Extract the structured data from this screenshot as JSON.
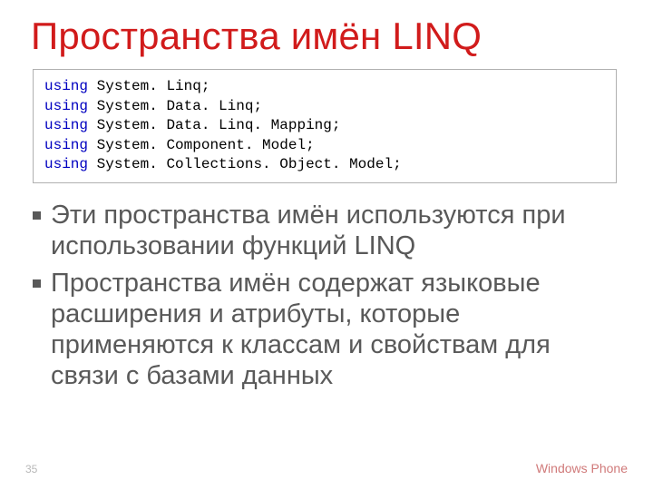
{
  "title": "Пространства имён LINQ",
  "code": {
    "keyword": "using",
    "lines": [
      "System. Linq;",
      "System. Data. Linq;",
      "System. Data. Linq. Mapping;",
      "System. Component. Model;",
      "System. Collections. Object. Model;"
    ]
  },
  "bullets": [
    "Эти пространства имён используются при использовании функций LINQ",
    "Пространства имён содержат языковые расширения и атрибуты, которые применяются к классам и свойствам для связи с базами данных"
  ],
  "footer": {
    "page": "35",
    "brand": "Windows Phone"
  }
}
